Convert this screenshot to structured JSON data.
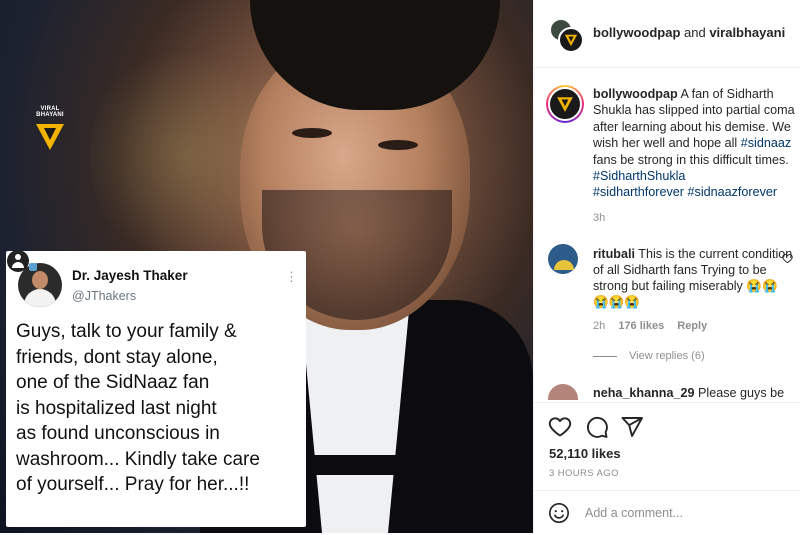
{
  "photo": {
    "watermark": "VIRAL BHAYANI",
    "tweet": {
      "name": "Dr. Jayesh Thaker",
      "handle": "@JThakers",
      "more": "⋮",
      "text": "Guys, talk to your family &\nfriends, dont stay alone,\none of the SidNaaz fan\nis hospitalized last night\nas found unconscious in\nwashroom... Kindly take care\nof yourself... Pray for her...!!"
    }
  },
  "header": {
    "account1": "bollywoodpap",
    "joiner": " and ",
    "account2": "viralbhayani"
  },
  "caption": {
    "username": "bollywoodpap",
    "text1": " A fan of Sidharth Shukla has slipped into partial coma after learning about his demise. We wish her well and hope all ",
    "tag1": "#sidnaaz",
    "text2": " fans be strong in this difficult times. ",
    "tag2": "#SidharthShukla",
    "tag3": "#sidharthforever",
    "tag4": "#sidnaazforever",
    "time": "3h"
  },
  "comments": [
    {
      "username": "ritubali",
      "text": " This is the current condition of all Sidharth fans Trying to be strong but failing miserably 😭😭😭😭😭",
      "time": "2h",
      "likes": "176 likes",
      "reply": "Reply",
      "view_replies": "View replies (6)"
    },
    {
      "username": "neha_khanna_29",
      "text": " Please guys be"
    }
  ],
  "stats": {
    "likes": "52,110 likes",
    "time": "3 HOURS AGO"
  },
  "add_comment": {
    "placeholder": "Add a comment..."
  },
  "colors": {
    "link": "#00376b",
    "muted": "#8e8e8e",
    "brand_gold": "#f2b200"
  }
}
